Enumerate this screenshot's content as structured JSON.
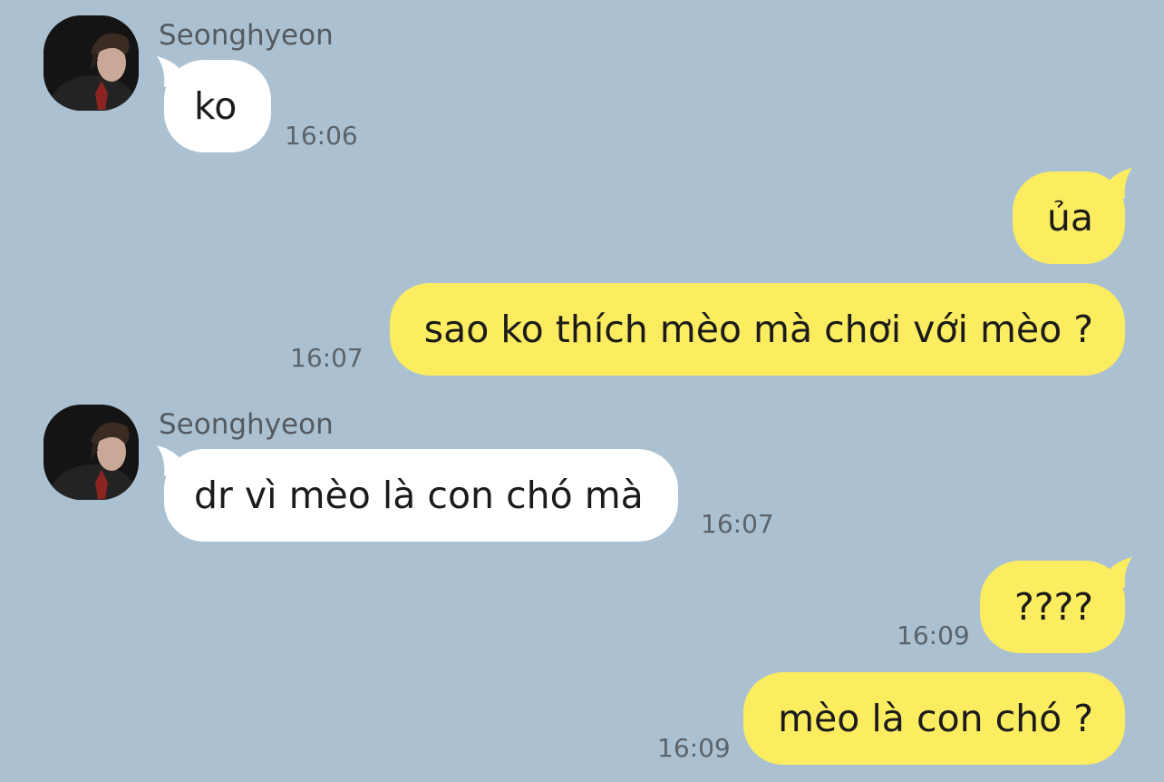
{
  "contact": {
    "name": "Seonghyeon"
  },
  "messages": [
    {
      "side": "in",
      "text": "ko",
      "time": "16:06"
    },
    {
      "side": "out",
      "text": "ủa",
      "time": ""
    },
    {
      "side": "out",
      "text": "sao ko thích mèo mà chơi với mèo ?",
      "time": "16:07"
    },
    {
      "side": "in",
      "text": "dr vì mèo là con chó mà",
      "time": "16:07"
    },
    {
      "side": "out",
      "text": "????",
      "time": "16:09"
    },
    {
      "side": "out",
      "text": "mèo là con chó ?",
      "time": "16:09"
    }
  ],
  "colors": {
    "background": "#abc1d1",
    "incoming_bubble": "#ffffff",
    "outgoing_bubble": "#fcec5f",
    "timestamp": "#5b636b"
  }
}
